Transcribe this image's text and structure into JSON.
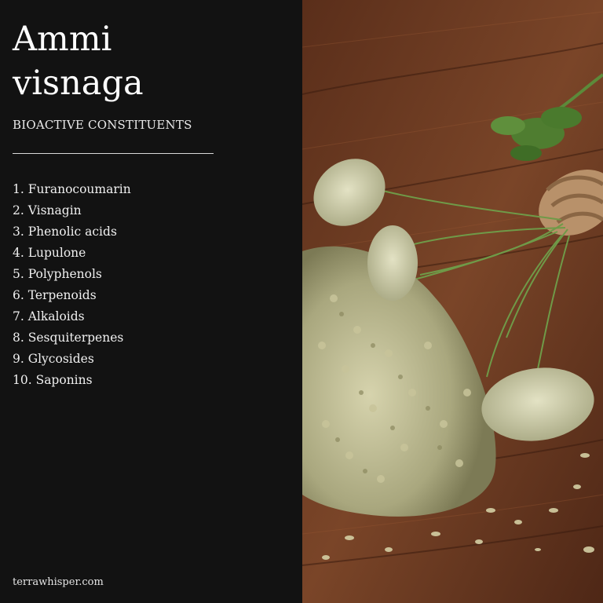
{
  "title_line1": "Ammi",
  "title_line2": "visnaga",
  "subtitle": "BIOACTIVE CONSTITUENTS",
  "constituents": [
    "1. Furanocoumarin",
    "2. Visnagin",
    "3. Phenolic acids",
    "4. Lupulone",
    "5. Polyphenols",
    "6. Terpenoids",
    "7. Alkaloids",
    "8. Sesquiterpenes",
    "9. Glycosides",
    "10. Saponins"
  ],
  "footer": "terrawhisper.com",
  "colors": {
    "panel_background": "#121212",
    "text": "#ffffff",
    "wood": "#6b3a22",
    "seed": "#c8c49a",
    "stem": "#5d8a3c"
  }
}
